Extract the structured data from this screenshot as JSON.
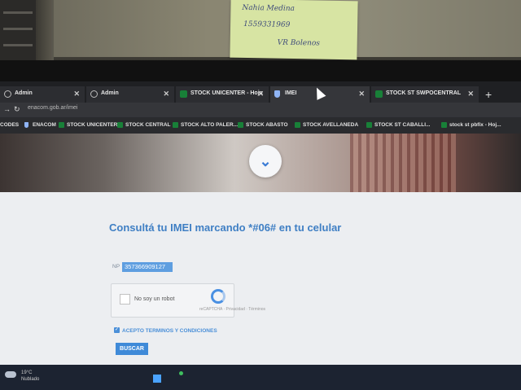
{
  "sticky_note": {
    "line1": "Nahia Medina",
    "line2": "1559331969",
    "line3": "VR Bolenos"
  },
  "browser": {
    "tabs": [
      {
        "label": "Admin",
        "icon": "globe-icon"
      },
      {
        "label": "Admin",
        "icon": "globe-icon"
      },
      {
        "label": "STOCK UNICENTER - Hoja",
        "icon": "sheets-icon"
      },
      {
        "label": "IMEI",
        "icon": "shield-icon"
      },
      {
        "label": "STOCK ST SWPOCENTRAL",
        "icon": "sheets-icon"
      }
    ],
    "url": "enacom.gob.ar/imei",
    "bookmarks": [
      {
        "label": "CODES",
        "icon": "none"
      },
      {
        "label": "ENACOM",
        "icon": "shield-icon"
      },
      {
        "label": "STOCK UNICENTER",
        "icon": "sheets-icon"
      },
      {
        "label": "STOCK CENTRAL",
        "icon": "sheets-icon"
      },
      {
        "label": "STOCK ALTO PALER...",
        "icon": "sheets-icon"
      },
      {
        "label": "STOCK ABASTO",
        "icon": "sheets-icon"
      },
      {
        "label": "STOCK AVELLANEDA",
        "icon": "sheets-icon"
      },
      {
        "label": "STOCK ST CABALLI...",
        "icon": "sheets-icon"
      },
      {
        "label": "stock st pbfix - Hoj...",
        "icon": "sheets-icon"
      }
    ]
  },
  "page": {
    "title": "Consultá tu IMEI marcando *#06# en tu celular",
    "imei_label": "NP",
    "imei_value": "357366909127",
    "captcha_label": "No soy un robot",
    "captcha_sub": "reCAPTCHA · Privacidad · Términos",
    "terms_label": "ACEPTO TERMINOS Y CONDICIONES",
    "search_button": "BUSCAR"
  },
  "taskbar": {
    "weather_temp": "19°C",
    "weather_desc": "Nublado"
  },
  "colors": {
    "accent": "#3f7fc4",
    "button": "#3f8ad8",
    "sheets_green": "#188038"
  }
}
